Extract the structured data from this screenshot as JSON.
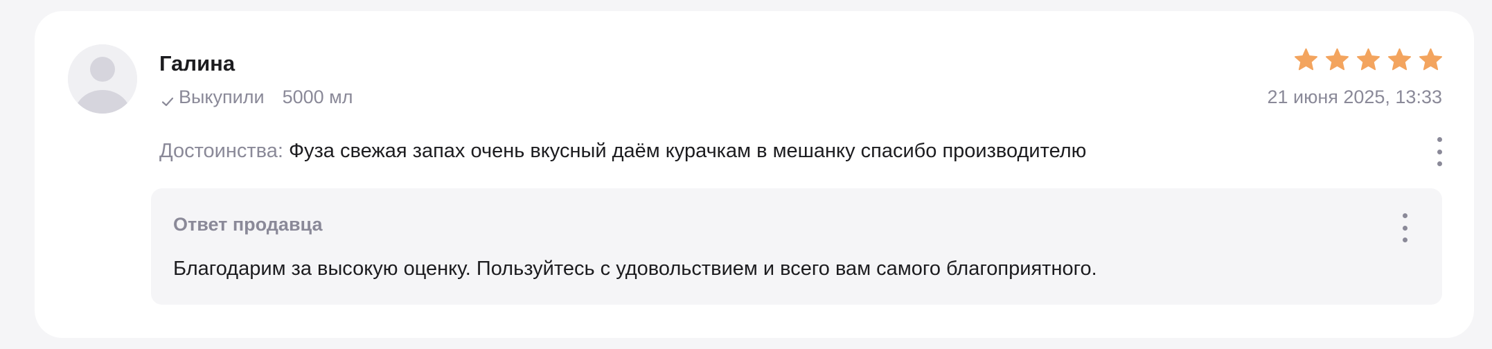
{
  "review": {
    "author": "Галина",
    "purchase_status": "Выкупили",
    "variant": "5000 мл",
    "rating": 5,
    "rating_max": 5,
    "date": "21 июня 2025, 13:33",
    "pros_label": "Достоинства:",
    "pros_text": "Фуза свежая запах очень вкусный даём курачкам в мешанку спасибо производителю",
    "icons": {
      "avatar": "user-placeholder-icon",
      "check": "check-icon",
      "star": "star-icon",
      "menu": "more-vertical-icon"
    },
    "colors": {
      "star": "#f3a45e",
      "muted_text": "#8a8998",
      "primary_text": "#1c1c1f",
      "card_bg": "#ffffff",
      "page_bg": "#f5f5f7"
    }
  },
  "seller_answer": {
    "title": "Ответ продавца",
    "text": "Благодарим за высокую оценку. Пользуйтесь с удовольствием и всего вам самого благоприятного."
  }
}
